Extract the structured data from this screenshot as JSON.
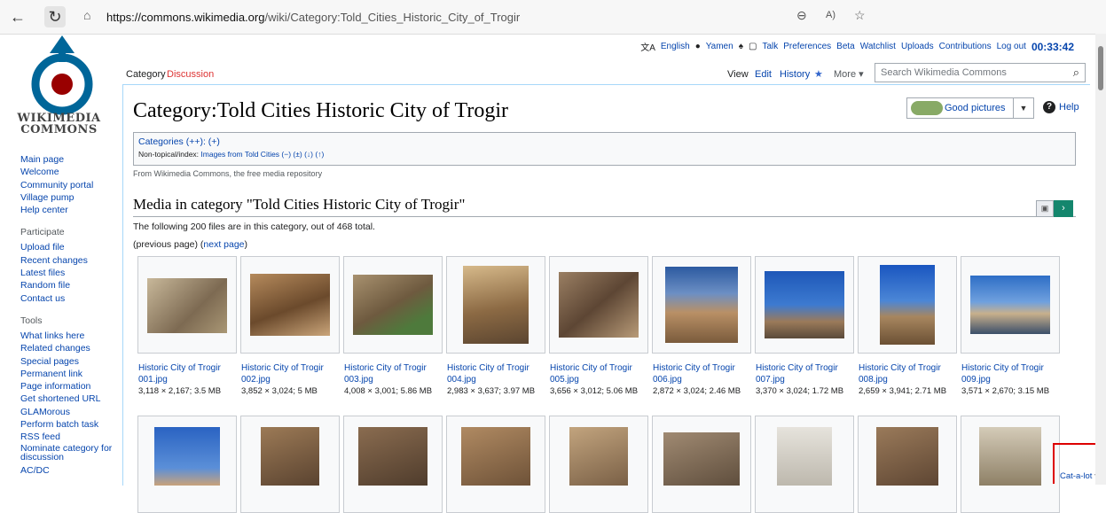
{
  "browser": {
    "url_host": "https://commons.wikimedia.org",
    "url_path": "/wiki/Category:Told_Cities_Historic_City_of_Trogir"
  },
  "logo": {
    "text_line1": "WIKIMEDIA",
    "text_line2": "COMMONS"
  },
  "personal": {
    "lang": "English",
    "user": "Yamen",
    "talk": "Talk",
    "prefs": "Preferences",
    "beta": "Beta",
    "watchlist": "Watchlist",
    "uploads": "Uploads",
    "contribs": "Contributions",
    "logout": "Log out",
    "clock": "00:33:42"
  },
  "tabs": {
    "category": "Category",
    "discussion": "Discussion",
    "view": "View",
    "edit": "Edit",
    "history": "History",
    "more": "More"
  },
  "search": {
    "placeholder": "Search Wikimedia Commons"
  },
  "sidebar": {
    "nav": [
      "Main page",
      "Welcome",
      "Community portal",
      "Village pump",
      "Help center"
    ],
    "participate_title": "Participate",
    "participate": [
      "Upload file",
      "Recent changes",
      "Latest files",
      "Random file",
      "Contact us"
    ],
    "tools_title": "Tools",
    "tools": [
      "What links here",
      "Related changes",
      "Special pages",
      "Permanent link",
      "Page information",
      "Get shortened URL",
      "GLAMorous",
      "Perform batch task",
      "RSS feed",
      "Nominate category for",
      "discussion",
      "AC/DC"
    ]
  },
  "page": {
    "title": "Category:Told Cities Historic City of Trogir",
    "good_pictures": "Good pictures",
    "help": "Help",
    "categories_line": "Categories (++): (+)",
    "nontopical_label": "Non-topical/index: ",
    "nontopical_link": "Images from Told Cities",
    "nontopical_ops": " (−) (±) (↓) (↑)",
    "sitesub": "From Wikimedia Commons, the free media repository",
    "media_heading": "Media in category \"Told Cities Historic City of Trogir\"",
    "count_text": "The following 200 files are in this category, out of 468 total.",
    "prev_page": "(previous page)",
    "next_page": "next page"
  },
  "gallery": [
    {
      "name1": "Historic City of Trogir",
      "name2": "001.jpg",
      "meta": "3,118 × 2,167; 3.5 MB"
    },
    {
      "name1": "Historic City of Trogir",
      "name2": "002.jpg",
      "meta": "3,852 × 3,024; 5 MB"
    },
    {
      "name1": "Historic City of Trogir",
      "name2": "003.jpg",
      "meta": "4,008 × 3,001; 5.86 MB"
    },
    {
      "name1": "Historic City of Trogir",
      "name2": "004.jpg",
      "meta": "2,983 × 3,637; 3.97 MB"
    },
    {
      "name1": "Historic City of Trogir",
      "name2": "005.jpg",
      "meta": "3,656 × 3,012; 5.06 MB"
    },
    {
      "name1": "Historic City of Trogir",
      "name2": "006.jpg",
      "meta": "2,872 × 3,024; 2.46 MB"
    },
    {
      "name1": "Historic City of Trogir",
      "name2": "007.jpg",
      "meta": "3,370 × 3,024; 1.72 MB"
    },
    {
      "name1": "Historic City of Trogir",
      "name2": "008.jpg",
      "meta": "2,659 × 3,941; 2.71 MB"
    },
    {
      "name1": "Historic City of Trogir",
      "name2": "009.jpg",
      "meta": "3,571 × 2,670; 3.15 MB"
    }
  ],
  "catalot": "Cat-a-lot"
}
